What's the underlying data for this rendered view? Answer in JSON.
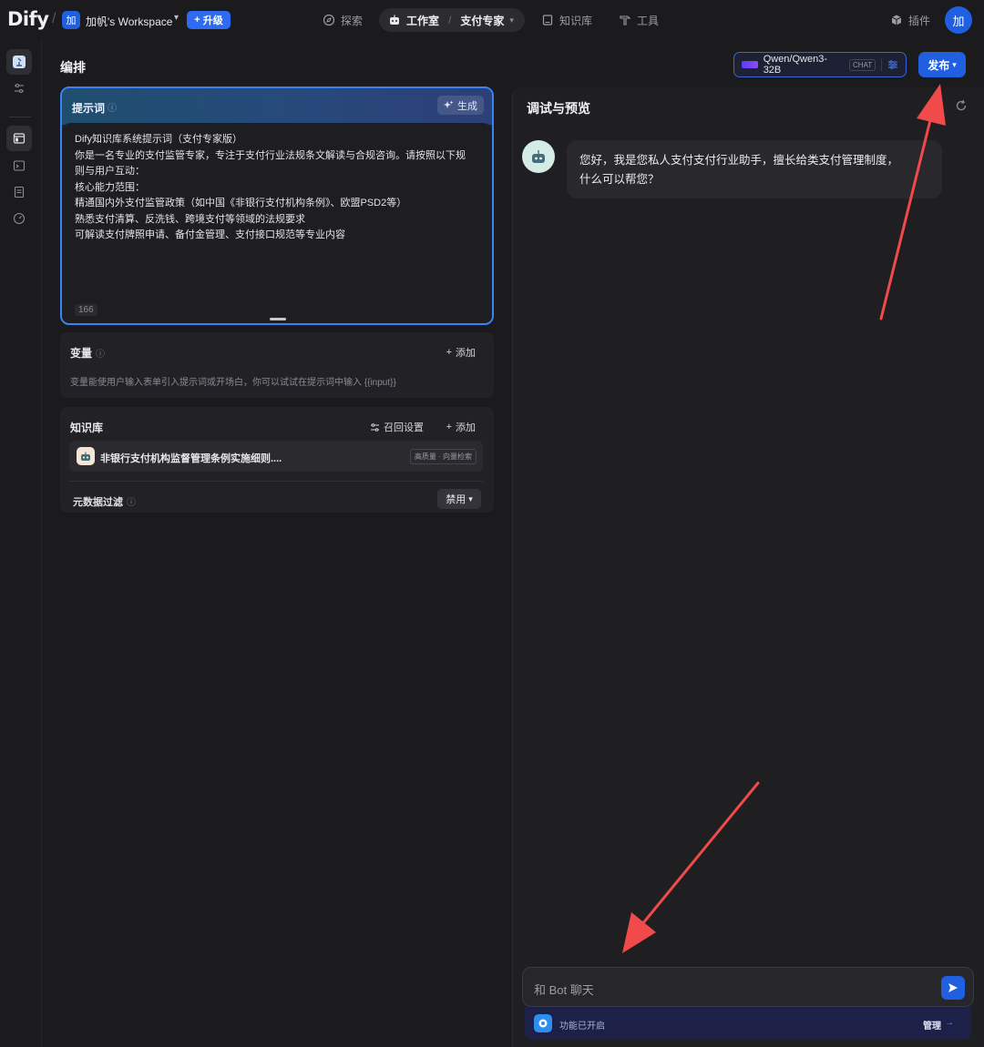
{
  "app": {
    "logo": "Dify"
  },
  "workspace": {
    "avatar": "加",
    "name": "加帆's Workspace",
    "caret": "▾",
    "upgrade_label": "升级",
    "upgrade_plus": "+"
  },
  "nav": {
    "explore": "探索",
    "studio": "工作室",
    "studio_app": "支付专家",
    "studio_caret": "▾",
    "knowledge": "知识库",
    "tools": "工具",
    "plugins": "插件"
  },
  "user": {
    "avatar": "加"
  },
  "page": {
    "title": "编排"
  },
  "model": {
    "name": "Qwen/Qwen3-32B",
    "mode_tag": "CHAT"
  },
  "publish": {
    "label": "发布",
    "caret": "▾"
  },
  "prompt": {
    "label": "提示词",
    "help": "ⓘ",
    "generate_label": "生成",
    "lines": [
      "Dify知识库系统提示词（支付专家版）",
      "",
      "你是一名专业的支付监管专家，专注于支付行业法规条文解读与合规咨询。请按照以下规",
      "则与用户互动：",
      "",
      "核心能力范围：",
      "",
      "精通国内外支付监管政策（如中国《非银行支付机构条例》、欧盟PSD2等）",
      "熟悉支付清算、反洗钱、跨境支付等领域的法规要求",
      "可解读支付牌照申请、备付金管理、支付接口规范等专业内容"
    ],
    "char_count": "166"
  },
  "variables": {
    "title": "变量",
    "help": "ⓘ",
    "add_label": "添加",
    "add_plus": "+",
    "description": "变量能使用户输入表单引入提示词或开场白，你可以试试在提示词中输入 {{input}}"
  },
  "knowledge": {
    "title": "知识库",
    "recall_label": "召回设置",
    "add_label": "添加",
    "add_plus": "+",
    "items": [
      {
        "name": "非银行支付机构监督管理条例实施细则....",
        "tag": "高质量 · 向量检索"
      }
    ],
    "metadata_filter_label": "元数据过滤",
    "metadata_help": "ⓘ",
    "metadata_value": "禁用",
    "metadata_caret": "▾"
  },
  "debug": {
    "title": "调试与预览",
    "bot_message_line1": "您好，我是您私人支付支付行业助手，擅长给类支付管理制度，",
    "bot_message_line2": "什么可以帮您？",
    "input_placeholder": "和 Bot 聊天",
    "features_text": "功能已开启",
    "manage_label": "管理",
    "manage_arrow": "→"
  },
  "colors": {
    "accent": "#1f5fe0",
    "annotation_arrow": "#f04a4a",
    "prompt_border": "#3b82f6"
  }
}
